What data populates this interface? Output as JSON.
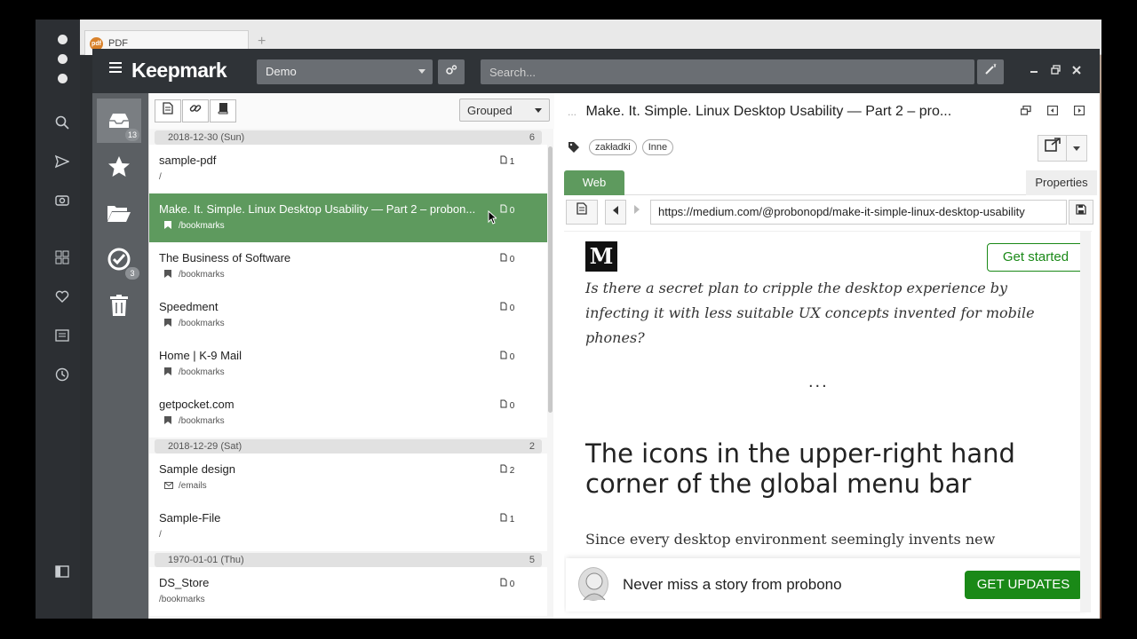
{
  "browser": {
    "tab_label": "PDF",
    "tab_badge": "pdf",
    "new_tab": "+"
  },
  "app": {
    "brand": "Keepmark",
    "collection": "Demo",
    "search_placeholder": "Search..."
  },
  "nav": {
    "inbox_count": "13",
    "tasks_count": "3"
  },
  "list": {
    "group_mode": "Grouped",
    "groups": [
      {
        "date": "2018-12-30 (Sun)",
        "count": "6",
        "items": [
          {
            "title": "sample-pdf",
            "path": "/",
            "notes": "1",
            "icon": "none"
          },
          {
            "title": "Make. It. Simple. Linux Desktop Usability — Part 2 – probon...",
            "path": "/bookmarks",
            "notes": "0",
            "icon": "bookmark",
            "selected": true
          },
          {
            "title": "The Business of Software",
            "path": "/bookmarks",
            "notes": "0",
            "icon": "bookmark"
          },
          {
            "title": "Speedment",
            "path": "/bookmarks",
            "notes": "0",
            "icon": "bookmark"
          },
          {
            "title": "Home | K-9 Mail",
            "path": "/bookmarks",
            "notes": "0",
            "icon": "bookmark"
          },
          {
            "title": "getpocket.com",
            "path": "/bookmarks",
            "notes": "0",
            "icon": "bookmark"
          }
        ]
      },
      {
        "date": "2018-12-29 (Sat)",
        "count": "2",
        "items": [
          {
            "title": "Sample design",
            "path": "/emails",
            "notes": "2",
            "icon": "email"
          },
          {
            "title": "Sample-File",
            "path": "/",
            "notes": "1",
            "icon": "none"
          }
        ]
      },
      {
        "date": "1970-01-01 (Thu)",
        "count": "5",
        "items": [
          {
            "title": "DS_Store",
            "path": "/bookmarks",
            "notes": "0",
            "icon": "none"
          }
        ]
      }
    ]
  },
  "detail": {
    "dots": "...",
    "title": "Make. It. Simple. Linux Desktop Usability — Part 2 – pro...",
    "tags": [
      "zakładki",
      "Inne"
    ],
    "tab_web": "Web",
    "tab_properties": "Properties",
    "url": "https://medium.com/@probonopd/make-it-simple-linux-desktop-usability"
  },
  "web": {
    "logo": "M",
    "get_started": "Get started",
    "quote": "Is there a secret plan to cripple the desktop experience by infecting it with less suitable UX concepts invented for mobile phones?",
    "separator": "...",
    "heading": "The icons in the upper-right hand corner of the global menu bar",
    "paragraph": "Since every desktop environment seemingly invents new terms",
    "banner_text": "Never miss a story from probono",
    "banner_button": "GET UPDATES"
  },
  "colors": {
    "accent_green": "#5e9a5e",
    "medium_green": "#1a8917",
    "topbar": "#2f3337",
    "sidenav": "#5b5f63"
  }
}
